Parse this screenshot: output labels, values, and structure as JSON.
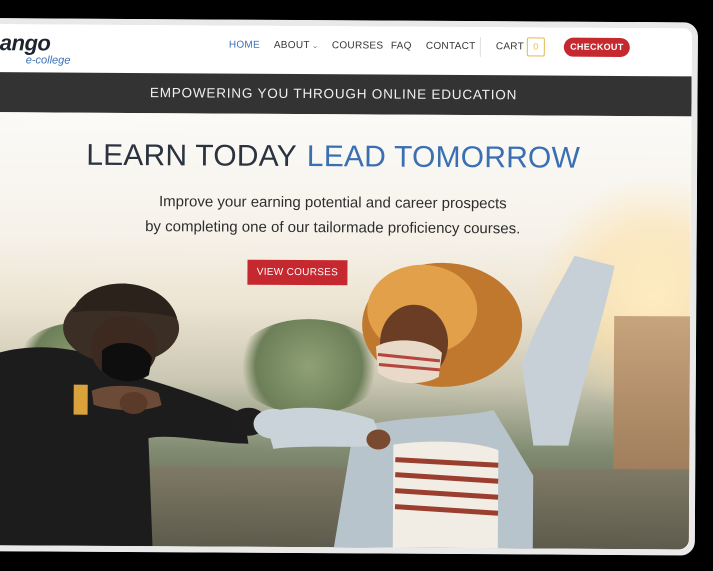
{
  "header": {
    "logo_main": "ango",
    "logo_sub": "e-college",
    "nav": [
      {
        "label": "HOME"
      },
      {
        "label": "ABOUT"
      },
      {
        "label": "COURSES"
      },
      {
        "label": "FAQ"
      },
      {
        "label": "CONTACT"
      }
    ],
    "cart_label": "CART",
    "cart_count": "0",
    "checkout_label": "CHECKOUT"
  },
  "banner": {
    "text": "EMPOWERING YOU THROUGH ONLINE EDUCATION"
  },
  "hero": {
    "headline_left": "LEARN TODAY",
    "headline_right": "LEAD TOMORROW",
    "sub_line1": "Improve your earning potential and career prospects",
    "sub_line2": "by completing one of our tailormade proficiency courses.",
    "button_label": "VIEW COURSES"
  },
  "colors": {
    "accent_blue": "#3b6fb3",
    "brand_red": "#c6282f",
    "banner_dark": "#333333"
  }
}
